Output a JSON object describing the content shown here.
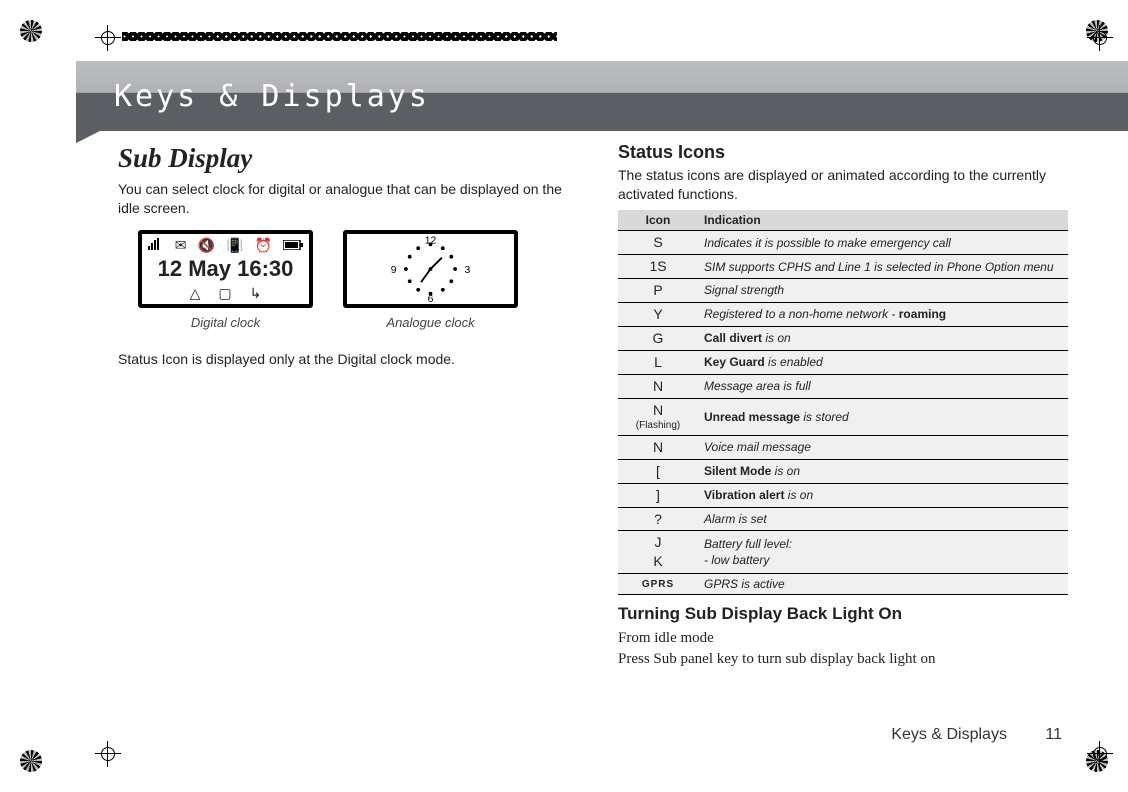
{
  "banner_title": "Keys & Displays",
  "left": {
    "heading": "Sub Display",
    "intro": "You can select clock for digital or analogue that can be displayed on the idle screen.",
    "digital_time": "12 May 16:30",
    "digital_label": "Digital clock",
    "analogue_label": "Analogue clock",
    "note": "Status Icon is displayed only at the Digital clock mode.",
    "analogue_numbers": {
      "top": "12",
      "right": "3",
      "bottom": "6",
      "left": "9"
    }
  },
  "right": {
    "heading": "Status Icons",
    "intro": "The status icons are displayed or animated according to the currently activated functions.",
    "table_headers": {
      "icon": "Icon",
      "indication": "Indication"
    },
    "rows": [
      {
        "icon": "S",
        "text": "Indicates it is possible to make emergency call"
      },
      {
        "icon": "1S",
        "text": "SIM supports CPHS and Line 1 is selected in Phone Option menu"
      },
      {
        "icon": "P",
        "text": "Signal strength"
      },
      {
        "icon": "Y",
        "text_pre": "Registered to a non-home network - ",
        "bold": "roaming"
      },
      {
        "icon": "G",
        "bold": "Call divert",
        "text_post": " is on"
      },
      {
        "icon": "L",
        "bold": "Key Guard",
        "text_post": " is enabled"
      },
      {
        "icon": "N",
        "text": "Message area is full"
      },
      {
        "icon": "N",
        "sub": "(Flashing)",
        "bold": "Unread message",
        "text_post": " is stored"
      },
      {
        "icon": "N",
        "text": "Voice mail message"
      },
      {
        "icon": "[",
        "bold": "Silent Mode",
        "text_post": " is on"
      },
      {
        "icon": "]",
        "bold": "Vibration alert",
        "text_post": " is on"
      },
      {
        "icon": "?",
        "text": "Alarm is set"
      },
      {
        "icon": "J\nK",
        "text": "Battery full level:\n- low battery"
      },
      {
        "icon": "GPRS",
        "small": true,
        "text": "GPRS is active"
      }
    ],
    "heading2": "Turning Sub Display Back Light On",
    "line1": "From idle mode",
    "line2": "Press Sub panel key to turn sub display back light on"
  },
  "footer": {
    "section": "Keys & Displays",
    "page": "11"
  }
}
